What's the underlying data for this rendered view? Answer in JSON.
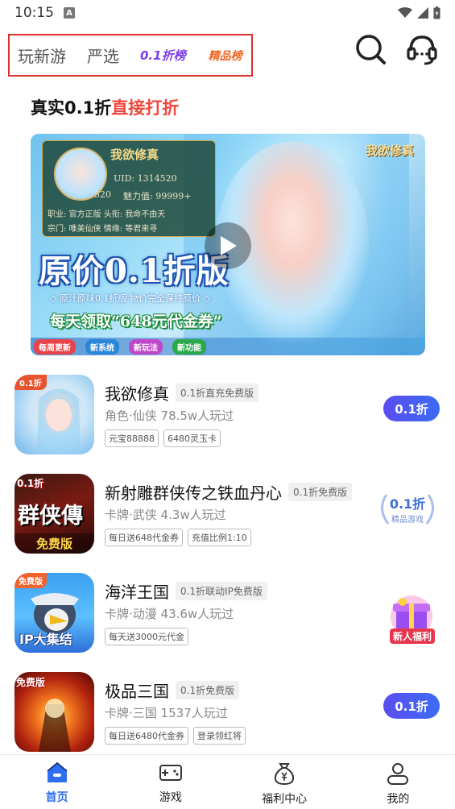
{
  "status_bar": {
    "time": "10:15",
    "notif_glyph": "A"
  },
  "top_nav": {
    "tabs": [
      {
        "label": "玩新游"
      },
      {
        "label": "严选"
      }
    ],
    "promo_tab_1": "0.1折榜",
    "promo_tab_2": "精品榜",
    "icons": [
      "search-icon",
      "headset-icon"
    ]
  },
  "headline": {
    "black": "真实0.1折",
    "red": "直接打折"
  },
  "banner": {
    "panel_name": "我欲修真",
    "uid": "UID: 1314520",
    "level": "520",
    "charm": "魅力值: 99999+",
    "rows": [
      "职业: 官方正版 头衔: 我命不由天",
      "宗门: 唯美仙侠 情缘: 等君来寻"
    ],
    "title": "原价0.1折版",
    "subtitle": "◇ 原汁原味0.1折版 物价完全保持原价 ◇",
    "coupon": "每天领取“648元代金券”",
    "strip": [
      "每周更新",
      "新系统",
      "新玩法",
      "新功能"
    ],
    "logo": "我欲修真"
  },
  "games": [
    {
      "title": "我欲修真",
      "badge": "0.1折直充免费版",
      "meta": "角色·仙侠  78.5w人玩过",
      "tags": [
        "元宝88888",
        "6480灵玉卡"
      ],
      "action": "0.1折",
      "icon_label": "0.1折"
    },
    {
      "title": "新射雕群侠传之铁血丹心",
      "badge": "0.1折免费版",
      "meta": "卡牌·武侠  4.3w人玩过",
      "tags": [
        "每日送648代金券",
        "充值比例1:10"
      ],
      "action_big": "0.1折",
      "action_small": "精品游戏",
      "icon_label": "群侠傳",
      "icon_sub": "免费版",
      "icon_corner": "0.1折"
    },
    {
      "title": "海洋王国",
      "badge": "0.1折联动IP免费版",
      "meta": "卡牌·动漫  43.6w人玩过",
      "tags": [
        "每天送3000元代金"
      ],
      "action_promo": "新人福利",
      "icon_label": "IP大集结",
      "icon_corner": "免费版"
    },
    {
      "title": "极品三国",
      "badge": "0.1折免费版",
      "meta": "卡牌·三国  1537人玩过",
      "tags": [
        "每日送6480代金券",
        "登录领红将"
      ],
      "action": "0.1折",
      "icon_corner": "免费版"
    }
  ],
  "bottom_nav": [
    {
      "label": "首页",
      "icon": "home-icon",
      "active": true
    },
    {
      "label": "游戏",
      "icon": "gamepad-icon",
      "active": false
    },
    {
      "label": "福利中心",
      "icon": "money-bag-icon",
      "active": false
    },
    {
      "label": "我的",
      "icon": "user-icon",
      "active": false
    }
  ],
  "colors": {
    "accent": "#2f6ef0",
    "red": "#f0473c",
    "discount_start": "#5b4cf0",
    "discount_end": "#3b6cf5"
  }
}
